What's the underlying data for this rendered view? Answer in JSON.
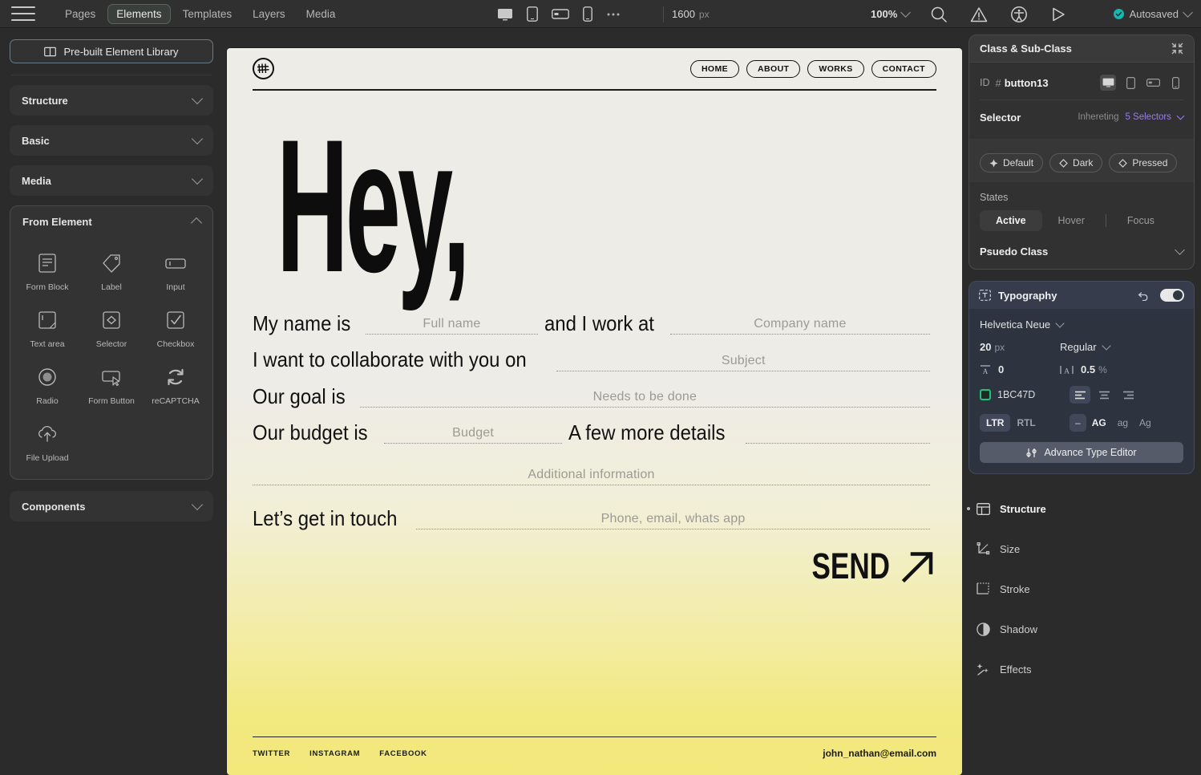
{
  "topbar": {
    "menu_icon": "hamburger-icon",
    "tabs": [
      {
        "label": "Pages",
        "active": false
      },
      {
        "label": "Elements",
        "active": true
      },
      {
        "label": "Templates",
        "active": false
      },
      {
        "label": "Layers",
        "active": false
      },
      {
        "label": "Media",
        "active": false
      }
    ],
    "devices": [
      "desktop-icon",
      "tablet-icon",
      "tablet-landscape-icon",
      "mobile-icon",
      "more-icon"
    ],
    "breakpoint_value": "1600",
    "breakpoint_unit": "px",
    "zoom": "100%",
    "icons": [
      "search-icon",
      "warning-icon",
      "accessibility-icon",
      "preview-play-icon"
    ],
    "save_status": "Autosaved"
  },
  "sidebar": {
    "library_button": "Pre-built Element Library",
    "accordions": [
      {
        "label": "Structure",
        "open": false
      },
      {
        "label": "Basic",
        "open": false
      },
      {
        "label": "Media",
        "open": false
      }
    ],
    "form_panel": {
      "label": "From Element",
      "open": true,
      "items": [
        {
          "label": "Form Block",
          "icon": "form-block-icon"
        },
        {
          "label": "Label",
          "icon": "label-tag-icon"
        },
        {
          "label": "Input",
          "icon": "input-field-icon"
        },
        {
          "label": "Text area",
          "icon": "text-area-icon"
        },
        {
          "label": "Selector",
          "icon": "selector-icon"
        },
        {
          "label": "Checkbox",
          "icon": "checkbox-icon"
        },
        {
          "label": "Radio",
          "icon": "radio-icon"
        },
        {
          "label": "Form Button",
          "icon": "form-button-icon"
        },
        {
          "label": "reCAPTCHA",
          "icon": "recaptcha-icon"
        },
        {
          "label": "File Upload",
          "icon": "file-upload-icon"
        }
      ]
    },
    "components_accordion": {
      "label": "Components",
      "open": false
    }
  },
  "canvas": {
    "site": {
      "logo": "monogram-logo-icon",
      "nav": [
        "HOME",
        "ABOUT",
        "WORKS",
        "CONTACT"
      ],
      "headline": "Hey,",
      "form_rows": [
        {
          "fields": [
            {
              "label": "My name is",
              "placeholder": "Full name",
              "value": ""
            },
            {
              "label": "and I work at",
              "placeholder": "Company name",
              "value": ""
            }
          ]
        },
        {
          "fields": [
            {
              "label": "I want to collaborate with you on",
              "placeholder": "Subject",
              "value": ""
            }
          ]
        },
        {
          "fields": [
            {
              "label": "Our goal is",
              "placeholder": "Needs to be done",
              "value": ""
            }
          ]
        },
        {
          "fields": [
            {
              "label": "Our budget is",
              "placeholder": "Budget",
              "value": ""
            },
            {
              "label": "A few more details",
              "placeholder": "",
              "value": ""
            }
          ]
        },
        {
          "fields": [
            {
              "label": "",
              "placeholder": "Additional information",
              "value": ""
            }
          ]
        },
        {
          "fields": [
            {
              "label": "Let’s get in touch",
              "placeholder": "Phone, email, whats app",
              "value": ""
            }
          ]
        }
      ],
      "send_label": "SEND",
      "send_icon": "arrow-up-right-icon",
      "socials": [
        "TWITTER",
        "INSTAGRAM",
        "FACEBOOK"
      ],
      "email": "john_nathan@email.com"
    }
  },
  "inspector": {
    "class_panel": {
      "title": "Class & Sub-Class",
      "collapse_icon": "collapse-arrows-icon",
      "id_label": "ID",
      "id_hash": "#",
      "id_value": "button13",
      "devices": [
        "desktop-icon",
        "tablet-icon",
        "tablet-landscape-icon",
        "mobile-icon"
      ],
      "selector_label": "Selector",
      "inheriting_label": "Inhereting",
      "selector_count": "5 Selectors",
      "chips": [
        {
          "label": "Default",
          "icon": "diamond-dots-icon"
        },
        {
          "label": "Dark",
          "icon": "diamond-icon"
        },
        {
          "label": "Pressed",
          "icon": "diamond-icon"
        }
      ],
      "states_label": "States",
      "states": [
        {
          "label": "Active",
          "active": true
        },
        {
          "label": "Hover",
          "active": false
        },
        {
          "label": "Focus",
          "active": false
        }
      ],
      "pseudo_class_label": "Psuedo Class"
    },
    "typography": {
      "title": "Typography",
      "icon": "type-icon",
      "reset_icon": "undo-icon",
      "enabled": true,
      "font_family": "Helvetica Neue",
      "font_size": "20",
      "font_size_unit": "px",
      "font_weight": "Regular",
      "line_height_icon": "line-height-icon",
      "line_height": "0",
      "letter_spacing_icon": "letter-spacing-icon",
      "letter_spacing": "0.5",
      "letter_spacing_unit": "%",
      "color_swatch_icon": "color-swatch-icon",
      "color_hex": "1BC47D",
      "align_options": [
        "align-left-icon",
        "align-center-icon",
        "align-right-icon"
      ],
      "align_active": 0,
      "direction": [
        {
          "label": "LTR",
          "active": true
        },
        {
          "label": "RTL",
          "active": false
        }
      ],
      "text_case": [
        {
          "label": "–",
          "active": false
        },
        {
          "label": "AG",
          "active": true
        },
        {
          "label": "ag",
          "active": false
        },
        {
          "label": "Ag",
          "active": false
        }
      ],
      "advance_button": "Advance Type Editor",
      "advance_icon": "sliders-icon"
    },
    "sections": [
      {
        "label": "Structure",
        "icon": "structure-icon",
        "active": true
      },
      {
        "label": "Size",
        "icon": "size-icon",
        "active": false
      },
      {
        "label": "Stroke",
        "icon": "stroke-icon",
        "active": false
      },
      {
        "label": "Shadow",
        "icon": "shadow-icon",
        "active": false
      },
      {
        "label": "Effects",
        "icon": "effects-icon",
        "active": false
      }
    ]
  },
  "colors": {
    "accent_green": "#1BC47D",
    "selector_purple": "#9A7EE6",
    "saved_teal": "#15B8B0",
    "canvas_top": "#EEECE7",
    "canvas_bottom": "#F2E87C"
  }
}
